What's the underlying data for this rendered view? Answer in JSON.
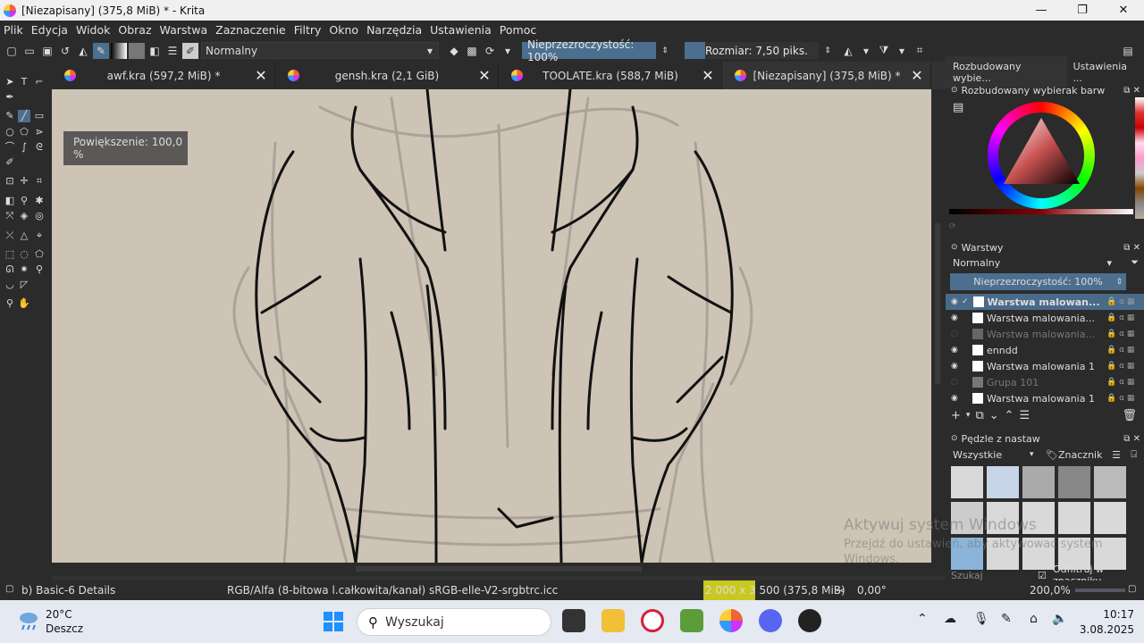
{
  "titlebar": {
    "title": "[Niezapisany]  (375,8 MiB) * - Krita",
    "minimize": "—",
    "maximize": "❐",
    "close": "✕"
  },
  "menu": [
    "Plik",
    "Edycja",
    "Widok",
    "Obraz",
    "Warstwa",
    "Zaznaczenie",
    "Filtry",
    "Okno",
    "Narzędzia",
    "Ustawienia",
    "Pomoc"
  ],
  "toolbar": {
    "blend_mode": "Normalny",
    "opacity_label": "Nieprzezroczystość: 100%",
    "size_label": "Rozmiar: 7,50 piks."
  },
  "tabs": [
    {
      "label": "awf.kra (597,2 MiB) *",
      "active": false
    },
    {
      "label": "gensh.kra (2,1 GiB)",
      "active": false
    },
    {
      "label": "TOOLATE.kra (588,7 MiB)",
      "active": false
    },
    {
      "label": "[Niezapisany]  (375,8 MiB) *",
      "active": true
    }
  ],
  "tab_close": "✕",
  "canvas": {
    "zoom_tooltip": "Powiększenie: 100,0 %"
  },
  "dockers": {
    "top_tabs": [
      "Rozbudowany wybie...",
      "Ustawienia ..."
    ],
    "color_selector_title": "Rozbudowany wybierak barw",
    "layers_title": "Warstwy",
    "layers_blend": "Normalny",
    "layers_opacity": "Nieprzezroczystość:  100%",
    "layers": [
      {
        "name": "Warstwa malowan...",
        "visible": true,
        "selected": true,
        "dim": false
      },
      {
        "name": "Warstwa malowania...",
        "visible": true,
        "selected": false,
        "dim": false
      },
      {
        "name": "Warstwa malowania...",
        "visible": false,
        "selected": false,
        "dim": true
      },
      {
        "name": "enndd",
        "visible": true,
        "selected": false,
        "dim": false
      },
      {
        "name": "Warstwa malowania 1",
        "visible": true,
        "selected": false,
        "dim": false
      },
      {
        "name": "Grupa 101",
        "visible": false,
        "selected": false,
        "dim": true
      },
      {
        "name": "Warstwa malowania 1",
        "visible": true,
        "selected": false,
        "dim": false
      }
    ],
    "brushes_title": "Pędzle z nastaw",
    "brushes_filter": "Wszystkie",
    "brushes_tag": "Znacznik",
    "brushes_search_placeholder": "Szukaj",
    "brushes_filter_tags": "Odfiltruj w znaczniku"
  },
  "watermark": {
    "line1": "Aktywuj system Windows",
    "line2": "Przejdź do ustawień, aby aktywować system",
    "line3": "Windows."
  },
  "statusbar": {
    "preset": "b) Basic-6 Details",
    "colorspace": "RGB/Alfa (8-bitowa l.całkowita/kanał)  sRGB-elle-V2-srgbtrc.icc",
    "image_size": "2 000 x 3 500 (375,8 MiB)",
    "rotation": "0,00°",
    "zoom": "200,0%"
  },
  "taskbar": {
    "temperature": "20°C",
    "weather": "Deszcz",
    "search_placeholder": "Wyszukaj",
    "time": "10:17",
    "date": "3.08.2025"
  }
}
